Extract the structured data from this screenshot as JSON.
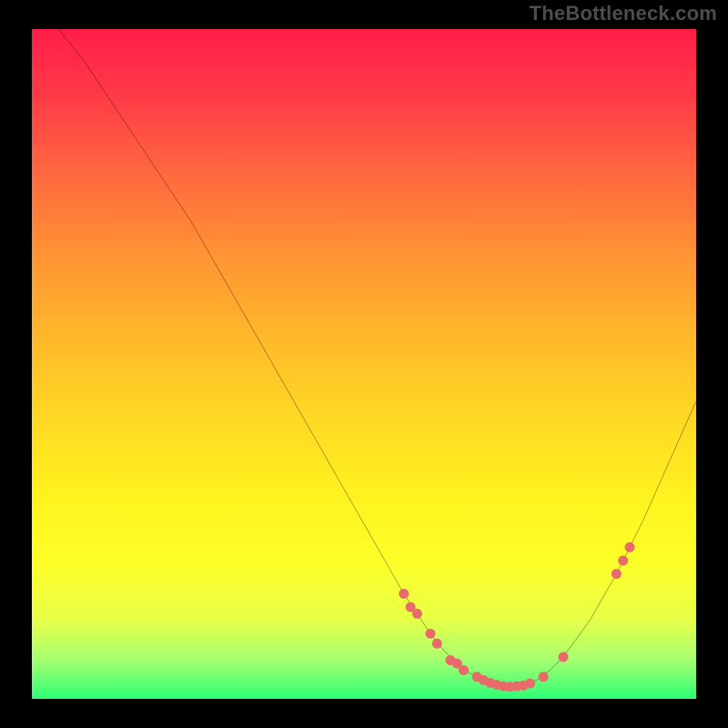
{
  "watermark": "TheBottleneck.com",
  "chart_data": {
    "type": "line",
    "title": "",
    "xlabel": "",
    "ylabel": "",
    "xlim": [
      0,
      100
    ],
    "ylim": [
      0,
      100
    ],
    "grid": false,
    "series": [
      {
        "name": "curve",
        "x": [
          4,
          8,
          12,
          16,
          20,
          24,
          28,
          32,
          36,
          40,
          44,
          48,
          52,
          56,
          58,
          60,
          62,
          64,
          66,
          68,
          70,
          72,
          74,
          76,
          78,
          80,
          84,
          88,
          92,
          96,
          100
        ],
        "y": [
          100,
          95,
          89,
          83,
          77,
          71,
          64,
          57,
          50,
          43,
          36,
          29,
          22,
          15,
          12,
          9,
          6.5,
          4.5,
          3,
          2,
          1.3,
          1,
          1.2,
          2,
          3.5,
          5.5,
          11,
          18,
          26,
          35,
          44
        ]
      }
    ],
    "markers": [
      {
        "x": 56,
        "y": 15
      },
      {
        "x": 57,
        "y": 13
      },
      {
        "x": 58,
        "y": 12
      },
      {
        "x": 60,
        "y": 9
      },
      {
        "x": 61,
        "y": 7.5
      },
      {
        "x": 63,
        "y": 5
      },
      {
        "x": 64,
        "y": 4.5
      },
      {
        "x": 65,
        "y": 3.5
      },
      {
        "x": 67,
        "y": 2.5
      },
      {
        "x": 68,
        "y": 2
      },
      {
        "x": 69,
        "y": 1.6
      },
      {
        "x": 70,
        "y": 1.3
      },
      {
        "x": 71,
        "y": 1.1
      },
      {
        "x": 72,
        "y": 1
      },
      {
        "x": 73,
        "y": 1.1
      },
      {
        "x": 74,
        "y": 1.2
      },
      {
        "x": 75,
        "y": 1.5
      },
      {
        "x": 77,
        "y": 2.5
      },
      {
        "x": 80,
        "y": 5.5
      },
      {
        "x": 88,
        "y": 18
      },
      {
        "x": 89,
        "y": 20
      },
      {
        "x": 90,
        "y": 22
      }
    ],
    "marker_color": "#e86a6a",
    "curve_color": "#000000",
    "background_gradient": {
      "top": "#ff1e4a",
      "bottom": "#2dff77"
    }
  }
}
